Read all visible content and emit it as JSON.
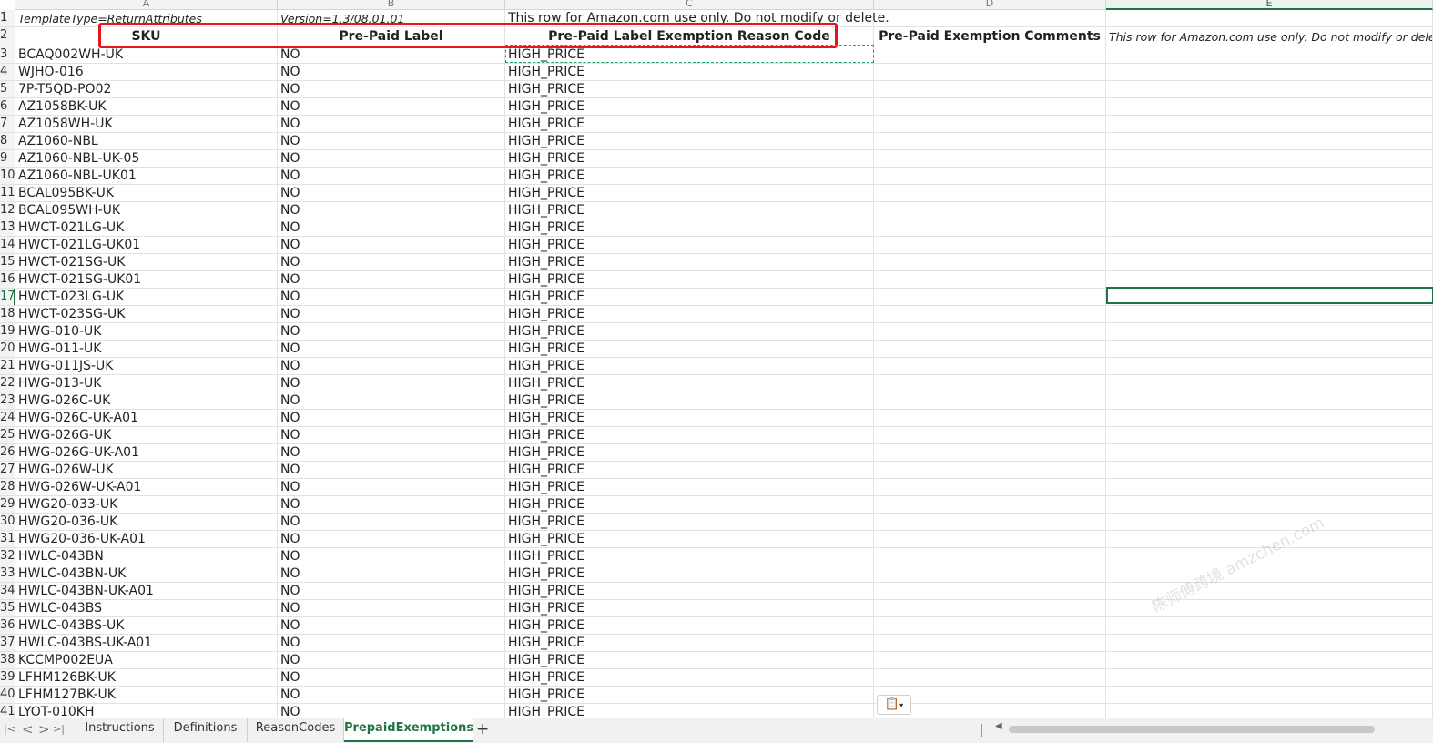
{
  "columns": [
    {
      "letter": "A"
    },
    {
      "letter": "B"
    },
    {
      "letter": "C"
    },
    {
      "letter": "D"
    },
    {
      "letter": "E"
    }
  ],
  "row1": {
    "a": "TemplateType=ReturnAttributes",
    "b": "Version=1.3/08.01.01",
    "c": "This row for Amazon.com use only.  Do not modify or delete."
  },
  "row2": {
    "a": "SKU",
    "b": "Pre-Paid Label",
    "c": "Pre-Paid Label Exemption Reason Code",
    "d": "Pre-Paid Exemption Comments",
    "e": "This row for Amazon.com use only.  Do not modify or delete."
  },
  "rows": [
    {
      "n": "3",
      "sku": "BCAQ002WH-UK",
      "label": "NO",
      "reason": "HIGH_PRICE"
    },
    {
      "n": "4",
      "sku": "WJHO-016",
      "label": "NO",
      "reason": "HIGH_PRICE"
    },
    {
      "n": "5",
      "sku": "7P-T5QD-PO02",
      "label": "NO",
      "reason": "HIGH_PRICE"
    },
    {
      "n": "6",
      "sku": "AZ1058BK-UK",
      "label": "NO",
      "reason": "HIGH_PRICE"
    },
    {
      "n": "7",
      "sku": "AZ1058WH-UK",
      "label": "NO",
      "reason": "HIGH_PRICE"
    },
    {
      "n": "8",
      "sku": "AZ1060-NBL",
      "label": "NO",
      "reason": "HIGH_PRICE"
    },
    {
      "n": "9",
      "sku": "AZ1060-NBL-UK-05",
      "label": "NO",
      "reason": "HIGH_PRICE"
    },
    {
      "n": "10",
      "sku": "AZ1060-NBL-UK01",
      "label": "NO",
      "reason": "HIGH_PRICE"
    },
    {
      "n": "11",
      "sku": "BCAL095BK-UK",
      "label": "NO",
      "reason": "HIGH_PRICE"
    },
    {
      "n": "12",
      "sku": "BCAL095WH-UK",
      "label": "NO",
      "reason": "HIGH_PRICE"
    },
    {
      "n": "13",
      "sku": "HWCT-021LG-UK",
      "label": "NO",
      "reason": "HIGH_PRICE"
    },
    {
      "n": "14",
      "sku": "HWCT-021LG-UK01",
      "label": "NO",
      "reason": "HIGH_PRICE"
    },
    {
      "n": "15",
      "sku": "HWCT-021SG-UK",
      "label": "NO",
      "reason": "HIGH_PRICE"
    },
    {
      "n": "16",
      "sku": "HWCT-021SG-UK01",
      "label": "NO",
      "reason": "HIGH_PRICE"
    },
    {
      "n": "17",
      "sku": "HWCT-023LG-UK",
      "label": "NO",
      "reason": "HIGH_PRICE"
    },
    {
      "n": "18",
      "sku": "HWCT-023SG-UK",
      "label": "NO",
      "reason": "HIGH_PRICE"
    },
    {
      "n": "19",
      "sku": "HWG-010-UK",
      "label": "NO",
      "reason": "HIGH_PRICE"
    },
    {
      "n": "20",
      "sku": "HWG-011-UK",
      "label": "NO",
      "reason": "HIGH_PRICE"
    },
    {
      "n": "21",
      "sku": "HWG-011JS-UK",
      "label": "NO",
      "reason": "HIGH_PRICE"
    },
    {
      "n": "22",
      "sku": "HWG-013-UK",
      "label": "NO",
      "reason": "HIGH_PRICE"
    },
    {
      "n": "23",
      "sku": "HWG-026C-UK",
      "label": "NO",
      "reason": "HIGH_PRICE"
    },
    {
      "n": "24",
      "sku": "HWG-026C-UK-A01",
      "label": "NO",
      "reason": "HIGH_PRICE"
    },
    {
      "n": "25",
      "sku": "HWG-026G-UK",
      "label": "NO",
      "reason": "HIGH_PRICE"
    },
    {
      "n": "26",
      "sku": "HWG-026G-UK-A01",
      "label": "NO",
      "reason": "HIGH_PRICE"
    },
    {
      "n": "27",
      "sku": "HWG-026W-UK",
      "label": "NO",
      "reason": "HIGH_PRICE"
    },
    {
      "n": "28",
      "sku": "HWG-026W-UK-A01",
      "label": "NO",
      "reason": "HIGH_PRICE"
    },
    {
      "n": "29",
      "sku": "HWG20-033-UK",
      "label": "NO",
      "reason": "HIGH_PRICE"
    },
    {
      "n": "30",
      "sku": "HWG20-036-UK",
      "label": "NO",
      "reason": "HIGH_PRICE"
    },
    {
      "n": "31",
      "sku": "HWG20-036-UK-A01",
      "label": "NO",
      "reason": "HIGH_PRICE"
    },
    {
      "n": "32",
      "sku": "HWLC-043BN",
      "label": "NO",
      "reason": "HIGH_PRICE"
    },
    {
      "n": "33",
      "sku": "HWLC-043BN-UK",
      "label": "NO",
      "reason": "HIGH_PRICE"
    },
    {
      "n": "34",
      "sku": "HWLC-043BN-UK-A01",
      "label": "NO",
      "reason": "HIGH_PRICE"
    },
    {
      "n": "35",
      "sku": "HWLC-043BS",
      "label": "NO",
      "reason": "HIGH_PRICE"
    },
    {
      "n": "36",
      "sku": "HWLC-043BS-UK",
      "label": "NO",
      "reason": "HIGH_PRICE"
    },
    {
      "n": "37",
      "sku": "HWLC-043BS-UK-A01",
      "label": "NO",
      "reason": "HIGH_PRICE"
    },
    {
      "n": "38",
      "sku": "KCCMP002EUA",
      "label": "NO",
      "reason": "HIGH_PRICE"
    },
    {
      "n": "39",
      "sku": "LFHM126BK-UK",
      "label": "NO",
      "reason": "HIGH_PRICE"
    },
    {
      "n": "40",
      "sku": "LFHM127BK-UK",
      "label": "NO",
      "reason": "HIGH_PRICE"
    },
    {
      "n": "41",
      "sku": "LYOT-010KH",
      "label": "NO",
      "reason": "HIGH_PRICE"
    }
  ],
  "selected_row": "17",
  "selected_column": "E",
  "watermark": "陈师傅跨境 amzchen.com",
  "paste_options_icon": "clipboard-icon",
  "tabs": [
    {
      "label": "Instructions",
      "active": false
    },
    {
      "label": "Definitions",
      "active": false
    },
    {
      "label": "ReasonCodes",
      "active": false
    },
    {
      "label": "PrepaidExemptions",
      "active": true
    }
  ],
  "nav": {
    "prev_all": "|<",
    "prev": "<",
    "next": ">",
    "next_all": ">|"
  },
  "add_sheet_label": "+",
  "colors": {
    "accent": "#217346",
    "highlight": "#e8141b",
    "marquee": "#1fa060"
  }
}
